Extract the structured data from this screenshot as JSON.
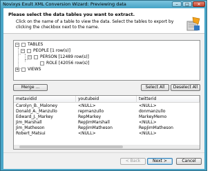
{
  "window": {
    "title": "Novixys Exult XML Conversion Wizard: Previewing data",
    "minimize_glyph": "–",
    "maximize_glyph": "□",
    "close_glyph": "✕"
  },
  "header": {
    "heading": "Please select the data tables you want to extract.",
    "description": "Click on the name of a table to view the data. Select the tables to export by clicking the checkbox next to the name.",
    "logo_icon": "wizard-logo-icon"
  },
  "tree": {
    "nodes": [
      {
        "label": "TABLES",
        "expander": "−"
      },
      {
        "label": "PEOPLE [1 row(s)]",
        "expander": "−"
      },
      {
        "label": "PERSON [12489 row(s)]",
        "expander": "−"
      },
      {
        "label": "ROLE [42056 row(s)]",
        "expander": ""
      },
      {
        "label": "VIEWS",
        "expander": "+"
      }
    ]
  },
  "buttons": {
    "merge": "Merge ...",
    "select_all": "Select All",
    "deselect_all": "Deselect All",
    "back": "< Back",
    "next": "Next >",
    "cancel": "Cancel"
  },
  "table": {
    "columns": [
      "metavidid",
      "youtubeid",
      "twitterid"
    ],
    "rows": [
      [
        "Carolyn_B._Maloney",
        "<NULL>",
        "<NULL>"
      ],
      [
        "Donald_A._Manzullo",
        "repmanzullo",
        "donmanzullo"
      ],
      [
        "Edward_J._Markey",
        "RepMarkey",
        "MarkeyMemo"
      ],
      [
        "Jim_Marshall",
        "RepJimMarshall",
        "<NULL>"
      ],
      [
        "Jim_Matheson",
        "RepJimMatheson",
        "RepJimMatheson"
      ],
      [
        "Robert_Matsui",
        "<NULL>",
        "<NULL>"
      ]
    ]
  }
}
